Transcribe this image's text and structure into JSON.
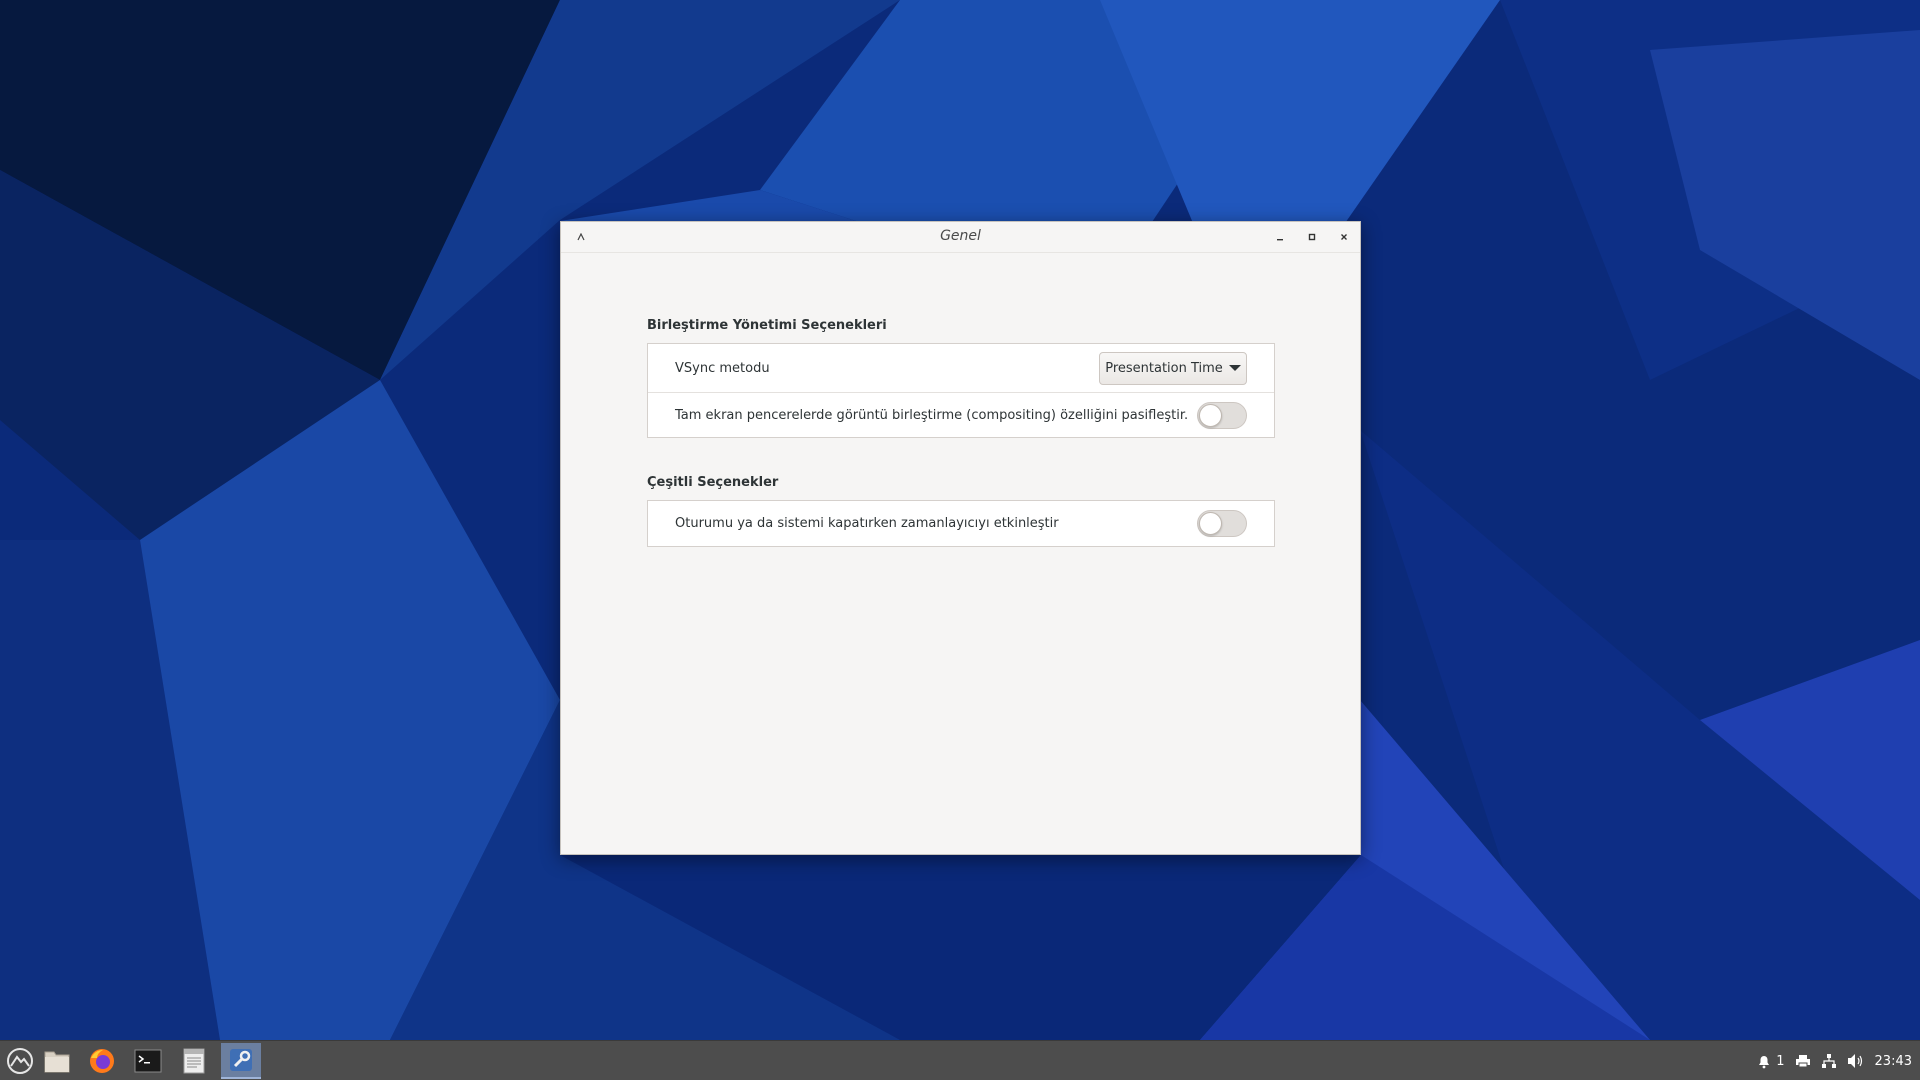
{
  "window": {
    "title": "Genel"
  },
  "compositor_section": {
    "title": "Birleştirme Yönetimi Seçenekleri",
    "vsync": {
      "label": "VSync metodu",
      "selected": "Presentation Time"
    },
    "fullscreen_unredirect": {
      "label": "Tam ekran pencerelerde görüntü birleştirme (compositing) özelliğini pasifleştir.",
      "enabled": false
    }
  },
  "misc_section": {
    "title": "Çeşitli Seçenekler",
    "timer": {
      "label": "Oturumu ya da sistemi kapatırken zamanlayıcıyı etkinleştir",
      "enabled": false
    }
  },
  "taskbar": {
    "apps": [
      {
        "icon": "menu-icon"
      },
      {
        "icon": "files-icon"
      },
      {
        "icon": "firefox-icon"
      },
      {
        "icon": "terminal-icon"
      },
      {
        "icon": "text-editor-icon"
      },
      {
        "icon": "settings-icon"
      }
    ],
    "tray": {
      "notification_count": "1",
      "clock": "23:43"
    }
  },
  "colors": {
    "desktop": "#0c2a78",
    "taskbar": "#4d4d4d",
    "window_bg": "#f6f5f4"
  }
}
